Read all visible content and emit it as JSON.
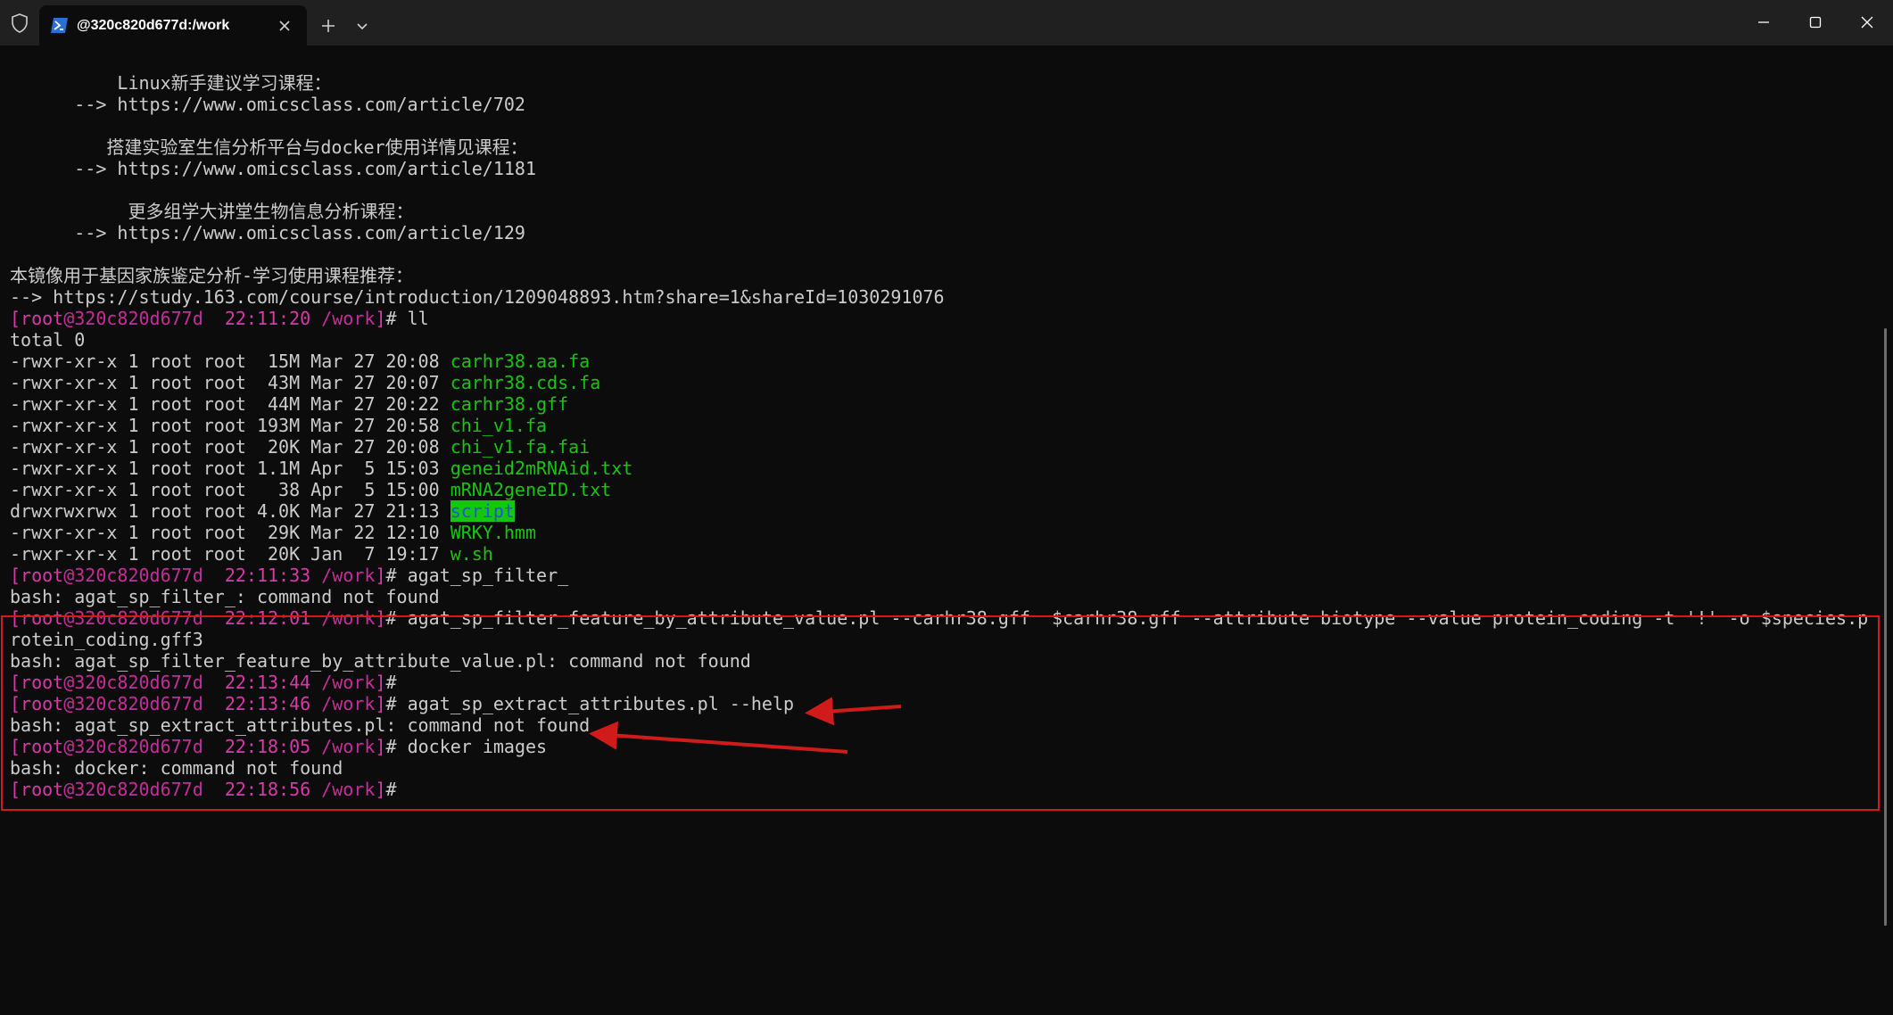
{
  "window": {
    "tab_title": "@320c820d677d:/work"
  },
  "icons": {
    "shield": "shield-icon",
    "tab": "powershell-icon",
    "tab_close": "close-icon",
    "new_tab": "plus-icon",
    "dropdown": "chevron-down-icon",
    "minimize": "minimize-icon",
    "maximize": "maximize-icon",
    "close": "close-icon"
  },
  "colors": {
    "background": "#0c0c0c",
    "text": "#cccccc",
    "prompt": "#d63aa8",
    "file": "#16c60c",
    "dir_fg": "#1f57d2",
    "dir_bg": "#16c60c",
    "annotation": "#d11b1b"
  },
  "terminal": {
    "lines": [
      [
        {
          "t": "          Linux新手建议学习课程：",
          "c": ""
        }
      ],
      [
        {
          "t": "      --> https://www.omicsclass.com/article/702",
          "c": ""
        }
      ],
      [
        {
          "t": "",
          "c": ""
        }
      ],
      [
        {
          "t": "         搭建实验室生信分析平台与docker使用详情见课程：",
          "c": ""
        }
      ],
      [
        {
          "t": "      --> https://www.omicsclass.com/article/1181",
          "c": ""
        }
      ],
      [
        {
          "t": "",
          "c": ""
        }
      ],
      [
        {
          "t": "           更多组学大讲堂生物信息分析课程：",
          "c": ""
        }
      ],
      [
        {
          "t": "      --> https://www.omicsclass.com/article/129",
          "c": ""
        }
      ],
      [
        {
          "t": "",
          "c": ""
        }
      ],
      [
        {
          "t": "本镜像用于基因家族鉴定分析-学习使用课程推荐：",
          "c": ""
        }
      ],
      [
        {
          "t": "--> https://study.163.com/course/introduction/1209048893.htm?share=1&shareId=1030291076",
          "c": ""
        }
      ],
      [
        {
          "t": "[root",
          "c": "user"
        },
        {
          "t": "@320c820d677d",
          "c": "host"
        },
        {
          "t": "  22:11:20",
          "c": "time"
        },
        {
          "t": " /work",
          "c": "path"
        },
        {
          "t": "]",
          "c": "user"
        },
        {
          "t": "# ll",
          "c": ""
        }
      ],
      [
        {
          "t": "total 0",
          "c": ""
        }
      ],
      [
        {
          "t": "-rwxr-xr-x 1 root root  15M Mar 27 20:08 ",
          "c": ""
        },
        {
          "t": "carhr38.aa.fa",
          "c": "file"
        }
      ],
      [
        {
          "t": "-rwxr-xr-x 1 root root  43M Mar 27 20:07 ",
          "c": ""
        },
        {
          "t": "carhr38.cds.fa",
          "c": "file"
        }
      ],
      [
        {
          "t": "-rwxr-xr-x 1 root root  44M Mar 27 20:22 ",
          "c": ""
        },
        {
          "t": "carhr38.gff",
          "c": "file"
        }
      ],
      [
        {
          "t": "-rwxr-xr-x 1 root root 193M Mar 27 20:58 ",
          "c": ""
        },
        {
          "t": "chi_v1.fa",
          "c": "file"
        }
      ],
      [
        {
          "t": "-rwxr-xr-x 1 root root  20K Mar 27 20:08 ",
          "c": ""
        },
        {
          "t": "chi_v1.fa.fai",
          "c": "file"
        }
      ],
      [
        {
          "t": "-rwxr-xr-x 1 root root 1.1M Apr  5 15:03 ",
          "c": ""
        },
        {
          "t": "geneid2mRNAid.txt",
          "c": "file"
        }
      ],
      [
        {
          "t": "-rwxr-xr-x 1 root root   38 Apr  5 15:00 ",
          "c": ""
        },
        {
          "t": "mRNA2geneID.txt",
          "c": "file"
        }
      ],
      [
        {
          "t": "drwxrwxrwx 1 root root 4.0K Mar 27 21:13 ",
          "c": ""
        },
        {
          "t": "script",
          "c": "dir"
        }
      ],
      [
        {
          "t": "-rwxr-xr-x 1 root root  29K Mar 22 12:10 ",
          "c": ""
        },
        {
          "t": "WRKY.hmm",
          "c": "file"
        }
      ],
      [
        {
          "t": "-rwxr-xr-x 1 root root  20K Jan  7 19:17 ",
          "c": ""
        },
        {
          "t": "w.sh",
          "c": "file"
        }
      ],
      [
        {
          "t": "[root",
          "c": "user"
        },
        {
          "t": "@320c820d677d",
          "c": "host"
        },
        {
          "t": "  22:11:33",
          "c": "time"
        },
        {
          "t": " /work",
          "c": "path"
        },
        {
          "t": "]",
          "c": "user"
        },
        {
          "t": "# agat_sp_filter_",
          "c": ""
        }
      ],
      [
        {
          "t": "bash: agat_sp_filter_: command not found",
          "c": ""
        }
      ],
      [
        {
          "t": "[root",
          "c": "user"
        },
        {
          "t": "@320c820d677d",
          "c": "host"
        },
        {
          "t": "  22:12:01",
          "c": "time"
        },
        {
          "t": " /work",
          "c": "path"
        },
        {
          "t": "]",
          "c": "user"
        },
        {
          "t": "# agat_sp_filter_feature_by_attribute_value.pl --carhr38.gff  $carhr38.gff --attribute biotype --value protein_coding -t '!' -o $species.p",
          "c": ""
        }
      ],
      [
        {
          "t": "rotein_coding.gff3",
          "c": ""
        }
      ],
      [
        {
          "t": "bash: agat_sp_filter_feature_by_attribute_value.pl: command not found",
          "c": ""
        }
      ],
      [
        {
          "t": "[root",
          "c": "user"
        },
        {
          "t": "@320c820d677d",
          "c": "host"
        },
        {
          "t": "  22:13:44",
          "c": "time"
        },
        {
          "t": " /work",
          "c": "path"
        },
        {
          "t": "]",
          "c": "user"
        },
        {
          "t": "#",
          "c": ""
        }
      ],
      [
        {
          "t": "[root",
          "c": "user"
        },
        {
          "t": "@320c820d677d",
          "c": "host"
        },
        {
          "t": "  22:13:46",
          "c": "time"
        },
        {
          "t": " /work",
          "c": "path"
        },
        {
          "t": "]",
          "c": "user"
        },
        {
          "t": "# agat_sp_extract_attributes.pl --help",
          "c": ""
        }
      ],
      [
        {
          "t": "bash: agat_sp_extract_attributes.pl: command not found",
          "c": ""
        }
      ],
      [
        {
          "t": "[root",
          "c": "user"
        },
        {
          "t": "@320c820d677d",
          "c": "host"
        },
        {
          "t": "  22:18:05",
          "c": "time"
        },
        {
          "t": " /work",
          "c": "path"
        },
        {
          "t": "]",
          "c": "user"
        },
        {
          "t": "# docker images",
          "c": ""
        }
      ],
      [
        {
          "t": "bash: docker: command not found",
          "c": ""
        }
      ],
      [
        {
          "t": "[root",
          "c": "user"
        },
        {
          "t": "@320c820d677d",
          "c": "host"
        },
        {
          "t": "  22:18:56",
          "c": "time"
        },
        {
          "t": " /work",
          "c": "path"
        },
        {
          "t": "]",
          "c": "user"
        },
        {
          "t": "#",
          "c": ""
        }
      ]
    ]
  }
}
